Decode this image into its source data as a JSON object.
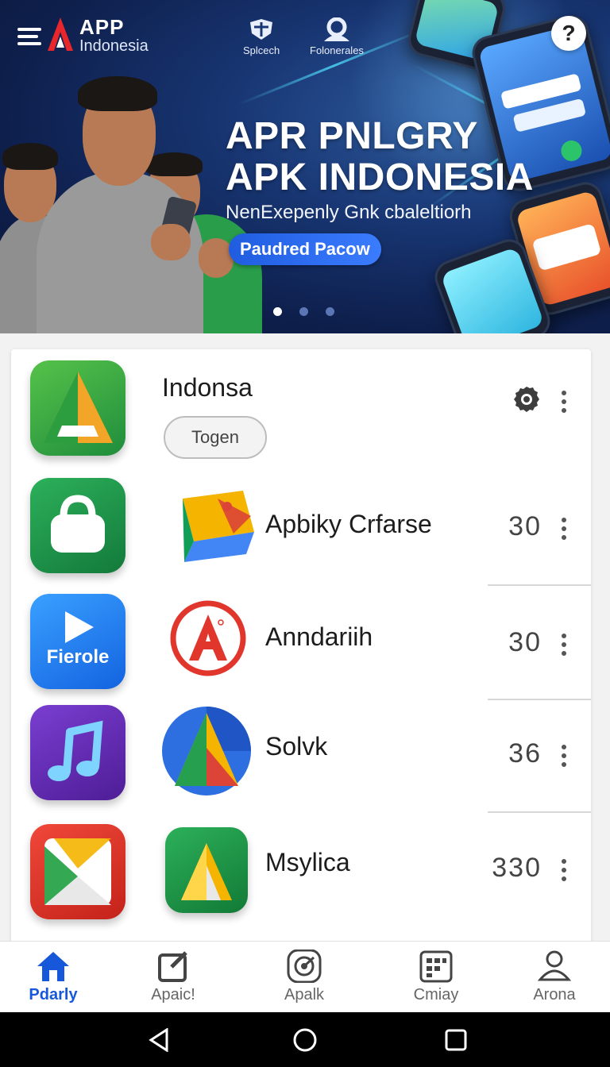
{
  "header": {
    "logo_title": "APP",
    "logo_subtitle": "Indonesia",
    "nav_items": [
      {
        "label": "Splcech",
        "icon": "crest-icon"
      },
      {
        "label": "Folonerales",
        "icon": "user-icon"
      }
    ],
    "help_label": "?"
  },
  "banner": {
    "title_line1": "APR PNLGRY",
    "title_line2": "APK INDONESIA",
    "subtitle": "NenExepenly Gnk cbaleltiorh",
    "cta_label": "Paudred Pacow",
    "slide_count": 3,
    "active_slide": 1
  },
  "app_list": {
    "first": {
      "name": "Indonsa",
      "toggle_label": "Togen",
      "icon": "settings-icon"
    },
    "rows": [
      {
        "name": "Apbiky Crfarse",
        "count": "30"
      },
      {
        "name": "Anndariih",
        "count": "30",
        "left_icon_label": "Fierole"
      },
      {
        "name": "Solvk",
        "count": "36"
      },
      {
        "name": "Msylica",
        "count": "330"
      }
    ]
  },
  "bottom_nav": {
    "items": [
      {
        "label": "Pdarly",
        "icon": "home-icon",
        "active": true
      },
      {
        "label": "Apaic!",
        "icon": "edit-icon",
        "active": false
      },
      {
        "label": "Apalk",
        "icon": "target-icon",
        "active": false
      },
      {
        "label": "Cmiay",
        "icon": "calendar-icon",
        "active": false
      },
      {
        "label": "Arona",
        "icon": "profile-icon",
        "active": false
      }
    ]
  },
  "colors": {
    "accent": "#1658d9",
    "banner_bg": "#183673",
    "cta": "#2f6fee"
  }
}
